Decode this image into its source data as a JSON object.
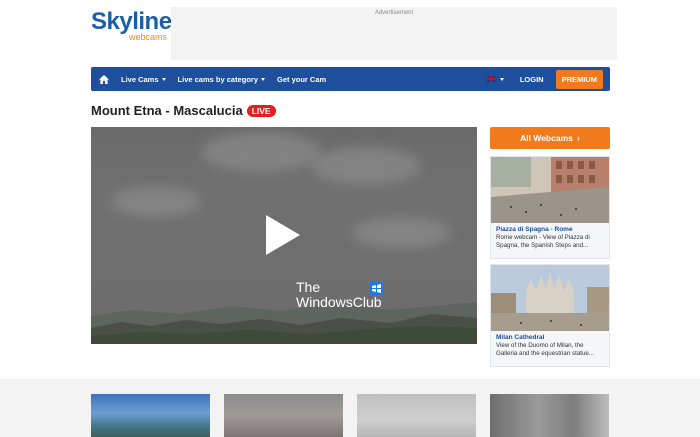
{
  "brand": {
    "name": "Skyline",
    "tagline": "webcams"
  },
  "ad": {
    "label": "Advertisement"
  },
  "nav": {
    "items": [
      {
        "label": "Live Cams",
        "has_dropdown": true
      },
      {
        "label": "Live cams by category",
        "has_dropdown": true
      },
      {
        "label": "Get your Cam",
        "has_dropdown": false
      }
    ],
    "login_label": "LOGIN",
    "premium_label": "PREMIUM",
    "colors": {
      "bar": "#1d4f9c",
      "premium": "#f07a1c"
    }
  },
  "page": {
    "title": "Mount Etna - Mascalucia",
    "live_badge": "LIVE"
  },
  "player": {
    "watermark_line1": "The",
    "watermark_line2": "WindowsClub"
  },
  "sidebar": {
    "all_webcams_label": "All Webcams",
    "cards": [
      {
        "title": "Piazza di Spagna - Rome",
        "description": "Rome webcam - View of Piazza di Spagna, the Spanish Steps and..."
      },
      {
        "title": "Milan Cathedral",
        "description": "View of the Duomo of Milan, the Galleria and the equestrian statue..."
      }
    ]
  }
}
